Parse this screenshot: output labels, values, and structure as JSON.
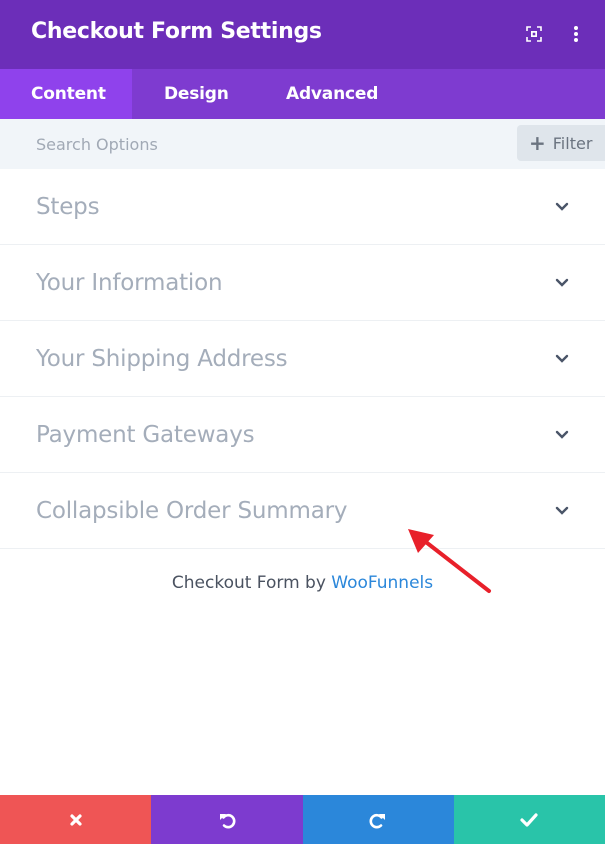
{
  "header": {
    "title": "Checkout Form Settings",
    "icons": [
      "expand-icon",
      "more-vertical-icon"
    ]
  },
  "tabs": [
    {
      "label": "Content",
      "active": true
    },
    {
      "label": "Design",
      "active": false
    },
    {
      "label": "Advanced",
      "active": false
    }
  ],
  "search": {
    "placeholder": "Search Options",
    "value": "",
    "filter_label": "Filter"
  },
  "sections": [
    {
      "label": "Steps"
    },
    {
      "label": "Your Information"
    },
    {
      "label": "Your Shipping Address"
    },
    {
      "label": "Payment Gateways"
    },
    {
      "label": "Collapsible Order Summary"
    }
  ],
  "credit": {
    "prefix": "Checkout Form by",
    "link": "WooFunnels"
  },
  "annotation": {
    "type": "red-arrow",
    "color": "#e8202a",
    "points_to": "Collapsible Order Summary"
  },
  "footer": {
    "buttons": [
      {
        "name": "discard",
        "icon": "close-icon",
        "color": "#ef5555"
      },
      {
        "name": "undo",
        "icon": "undo-icon",
        "color": "#7d3bcf"
      },
      {
        "name": "redo",
        "icon": "redo-icon",
        "color": "#2b87da"
      },
      {
        "name": "save",
        "icon": "check-icon",
        "color": "#29c4a9"
      }
    ]
  },
  "colors": {
    "header_bg": "#6c2eb9",
    "tabs_bg": "#7e3bd0",
    "active_tab_bg": "#8f42ec",
    "link": "#2b87da"
  }
}
